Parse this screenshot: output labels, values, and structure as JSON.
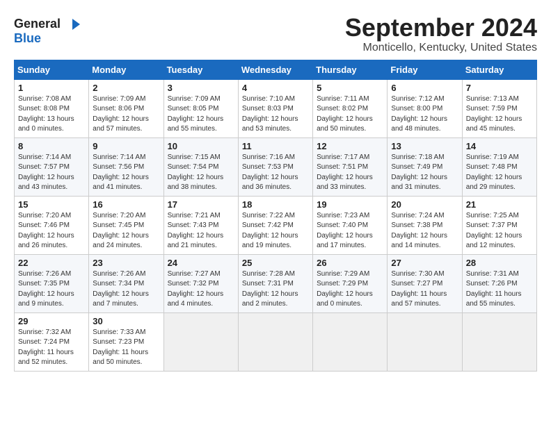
{
  "header": {
    "month_year": "September 2024",
    "location": "Monticello, Kentucky, United States",
    "logo_general": "General",
    "logo_blue": "Blue"
  },
  "columns": [
    "Sunday",
    "Monday",
    "Tuesday",
    "Wednesday",
    "Thursday",
    "Friday",
    "Saturday"
  ],
  "weeks": [
    [
      {
        "day": "1",
        "sunrise": "Sunrise: 7:08 AM",
        "sunset": "Sunset: 8:08 PM",
        "daylight": "Daylight: 13 hours and 0 minutes."
      },
      {
        "day": "2",
        "sunrise": "Sunrise: 7:09 AM",
        "sunset": "Sunset: 8:06 PM",
        "daylight": "Daylight: 12 hours and 57 minutes."
      },
      {
        "day": "3",
        "sunrise": "Sunrise: 7:09 AM",
        "sunset": "Sunset: 8:05 PM",
        "daylight": "Daylight: 12 hours and 55 minutes."
      },
      {
        "day": "4",
        "sunrise": "Sunrise: 7:10 AM",
        "sunset": "Sunset: 8:03 PM",
        "daylight": "Daylight: 12 hours and 53 minutes."
      },
      {
        "day": "5",
        "sunrise": "Sunrise: 7:11 AM",
        "sunset": "Sunset: 8:02 PM",
        "daylight": "Daylight: 12 hours and 50 minutes."
      },
      {
        "day": "6",
        "sunrise": "Sunrise: 7:12 AM",
        "sunset": "Sunset: 8:00 PM",
        "daylight": "Daylight: 12 hours and 48 minutes."
      },
      {
        "day": "7",
        "sunrise": "Sunrise: 7:13 AM",
        "sunset": "Sunset: 7:59 PM",
        "daylight": "Daylight: 12 hours and 45 minutes."
      }
    ],
    [
      {
        "day": "8",
        "sunrise": "Sunrise: 7:14 AM",
        "sunset": "Sunset: 7:57 PM",
        "daylight": "Daylight: 12 hours and 43 minutes."
      },
      {
        "day": "9",
        "sunrise": "Sunrise: 7:14 AM",
        "sunset": "Sunset: 7:56 PM",
        "daylight": "Daylight: 12 hours and 41 minutes."
      },
      {
        "day": "10",
        "sunrise": "Sunrise: 7:15 AM",
        "sunset": "Sunset: 7:54 PM",
        "daylight": "Daylight: 12 hours and 38 minutes."
      },
      {
        "day": "11",
        "sunrise": "Sunrise: 7:16 AM",
        "sunset": "Sunset: 7:53 PM",
        "daylight": "Daylight: 12 hours and 36 minutes."
      },
      {
        "day": "12",
        "sunrise": "Sunrise: 7:17 AM",
        "sunset": "Sunset: 7:51 PM",
        "daylight": "Daylight: 12 hours and 33 minutes."
      },
      {
        "day": "13",
        "sunrise": "Sunrise: 7:18 AM",
        "sunset": "Sunset: 7:49 PM",
        "daylight": "Daylight: 12 hours and 31 minutes."
      },
      {
        "day": "14",
        "sunrise": "Sunrise: 7:19 AM",
        "sunset": "Sunset: 7:48 PM",
        "daylight": "Daylight: 12 hours and 29 minutes."
      }
    ],
    [
      {
        "day": "15",
        "sunrise": "Sunrise: 7:20 AM",
        "sunset": "Sunset: 7:46 PM",
        "daylight": "Daylight: 12 hours and 26 minutes."
      },
      {
        "day": "16",
        "sunrise": "Sunrise: 7:20 AM",
        "sunset": "Sunset: 7:45 PM",
        "daylight": "Daylight: 12 hours and 24 minutes."
      },
      {
        "day": "17",
        "sunrise": "Sunrise: 7:21 AM",
        "sunset": "Sunset: 7:43 PM",
        "daylight": "Daylight: 12 hours and 21 minutes."
      },
      {
        "day": "18",
        "sunrise": "Sunrise: 7:22 AM",
        "sunset": "Sunset: 7:42 PM",
        "daylight": "Daylight: 12 hours and 19 minutes."
      },
      {
        "day": "19",
        "sunrise": "Sunrise: 7:23 AM",
        "sunset": "Sunset: 7:40 PM",
        "daylight": "Daylight: 12 hours and 17 minutes."
      },
      {
        "day": "20",
        "sunrise": "Sunrise: 7:24 AM",
        "sunset": "Sunset: 7:38 PM",
        "daylight": "Daylight: 12 hours and 14 minutes."
      },
      {
        "day": "21",
        "sunrise": "Sunrise: 7:25 AM",
        "sunset": "Sunset: 7:37 PM",
        "daylight": "Daylight: 12 hours and 12 minutes."
      }
    ],
    [
      {
        "day": "22",
        "sunrise": "Sunrise: 7:26 AM",
        "sunset": "Sunset: 7:35 PM",
        "daylight": "Daylight: 12 hours and 9 minutes."
      },
      {
        "day": "23",
        "sunrise": "Sunrise: 7:26 AM",
        "sunset": "Sunset: 7:34 PM",
        "daylight": "Daylight: 12 hours and 7 minutes."
      },
      {
        "day": "24",
        "sunrise": "Sunrise: 7:27 AM",
        "sunset": "Sunset: 7:32 PM",
        "daylight": "Daylight: 12 hours and 4 minutes."
      },
      {
        "day": "25",
        "sunrise": "Sunrise: 7:28 AM",
        "sunset": "Sunset: 7:31 PM",
        "daylight": "Daylight: 12 hours and 2 minutes."
      },
      {
        "day": "26",
        "sunrise": "Sunrise: 7:29 AM",
        "sunset": "Sunset: 7:29 PM",
        "daylight": "Daylight: 12 hours and 0 minutes."
      },
      {
        "day": "27",
        "sunrise": "Sunrise: 7:30 AM",
        "sunset": "Sunset: 7:27 PM",
        "daylight": "Daylight: 11 hours and 57 minutes."
      },
      {
        "day": "28",
        "sunrise": "Sunrise: 7:31 AM",
        "sunset": "Sunset: 7:26 PM",
        "daylight": "Daylight: 11 hours and 55 minutes."
      }
    ],
    [
      {
        "day": "29",
        "sunrise": "Sunrise: 7:32 AM",
        "sunset": "Sunset: 7:24 PM",
        "daylight": "Daylight: 11 hours and 52 minutes."
      },
      {
        "day": "30",
        "sunrise": "Sunrise: 7:33 AM",
        "sunset": "Sunset: 7:23 PM",
        "daylight": "Daylight: 11 hours and 50 minutes."
      },
      null,
      null,
      null,
      null,
      null
    ]
  ]
}
